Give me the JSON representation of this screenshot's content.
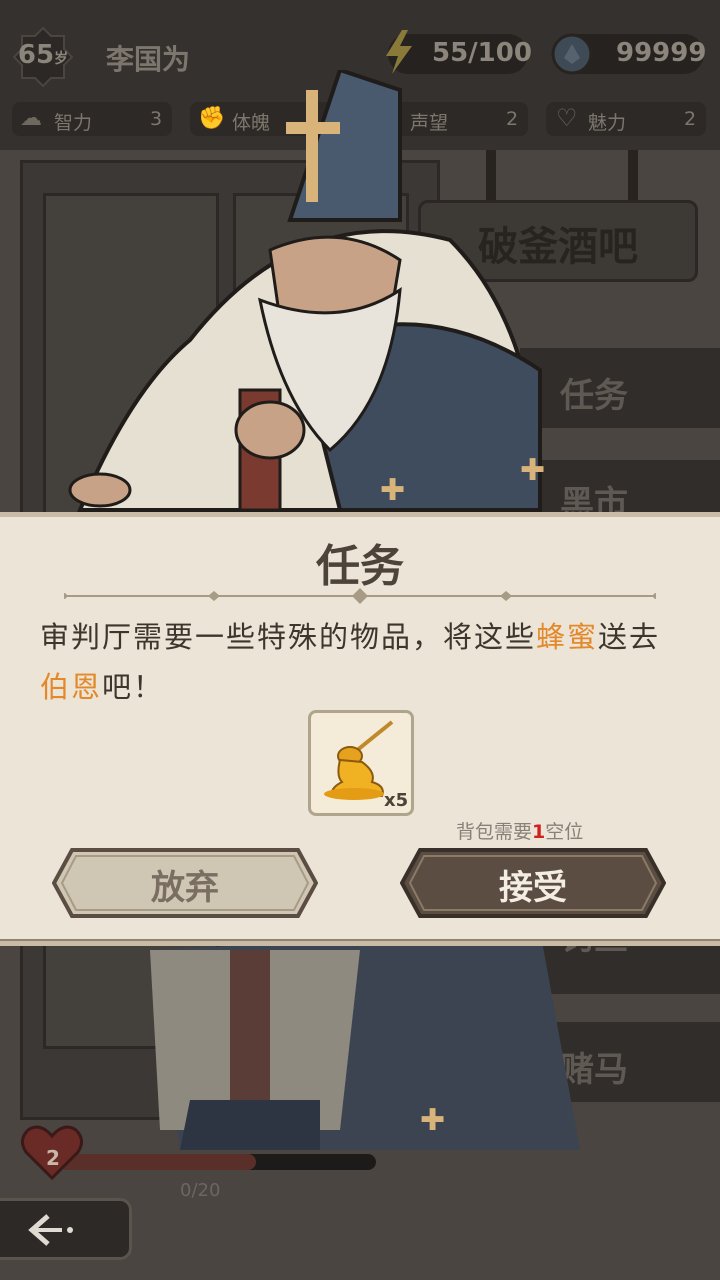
{
  "player": {
    "age": "65",
    "age_unit": "岁",
    "name": "李国为"
  },
  "resources": {
    "energy": "55/100",
    "gems": "99999"
  },
  "stats": [
    {
      "label": "智力",
      "value": "3",
      "icon": "brain-icon"
    },
    {
      "label": "体魄",
      "value": "",
      "icon": "muscle-icon"
    },
    {
      "label": "声望",
      "value": "2",
      "icon": "reputation-icon"
    },
    {
      "label": "魅力",
      "value": "2",
      "icon": "heart-charm-icon"
    }
  ],
  "location": {
    "name": "破釜酒吧"
  },
  "menu": [
    "任务",
    "黑市",
    "钓鱼",
    "赌马"
  ],
  "hud": {
    "hearts": "2",
    "progress": "0/20"
  },
  "dialog": {
    "title": "任务",
    "message_parts": [
      {
        "text": "审判厅需要一些特殊的物品，将这些",
        "highlight": false
      },
      {
        "text": "蜂蜜",
        "highlight": true
      },
      {
        "text": "送去",
        "highlight": false
      },
      {
        "text": "伯恩",
        "highlight": true
      },
      {
        "text": "吧！",
        "highlight": false
      }
    ],
    "item": {
      "icon": "honey-icon",
      "quantity": "x5"
    },
    "bag_note": {
      "prefix": "背包需要",
      "count": "1",
      "suffix": "空位"
    },
    "abandon_label": "放弃",
    "accept_label": "接受"
  },
  "colors": {
    "highlight": "#e4892a",
    "dialog_bg": "#ebe4d7",
    "accept_bg": "#5b4d42",
    "abandon_bg": "#cfc6b4"
  }
}
